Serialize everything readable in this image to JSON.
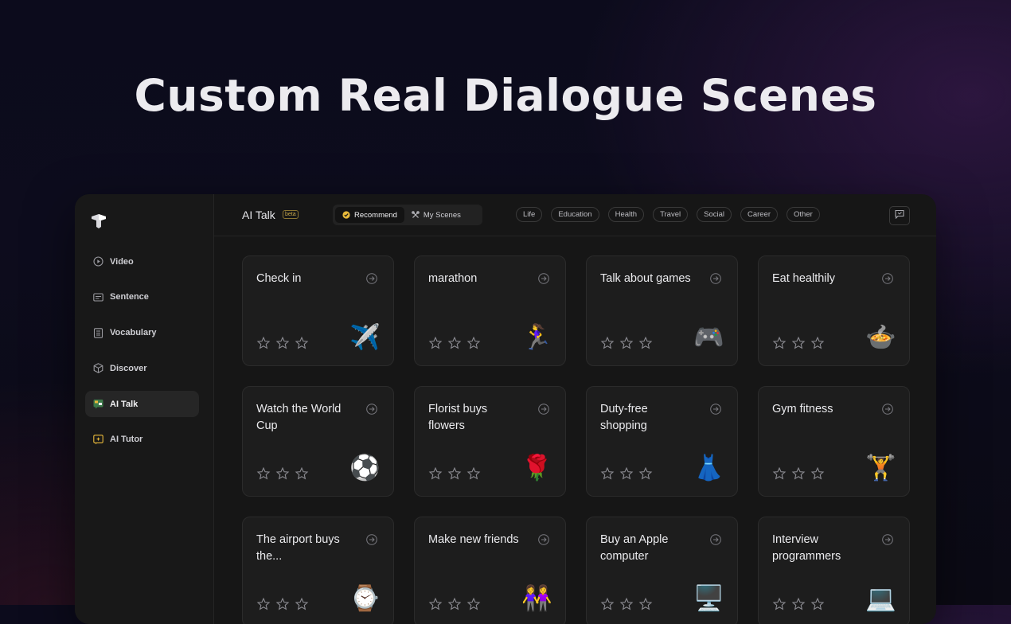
{
  "hero": {
    "title": "Custom Real Dialogue Scenes"
  },
  "sidebar": {
    "items": [
      {
        "label": "Video",
        "icon": "play-circle-icon",
        "active": false
      },
      {
        "label": "Sentence",
        "icon": "subtitle-icon",
        "active": false
      },
      {
        "label": "Vocabulary",
        "icon": "list-icon",
        "active": false
      },
      {
        "label": "Discover",
        "icon": "cube-icon",
        "active": false
      },
      {
        "label": "AI Talk",
        "icon": "ai-talk-icon",
        "active": true
      },
      {
        "label": "AI Tutor",
        "icon": "ai-tutor-icon",
        "active": false
      }
    ]
  },
  "header": {
    "title": "AI Talk",
    "badge": "beta",
    "tabs": [
      {
        "label": "Recommend",
        "active": true
      },
      {
        "label": "My Scenes",
        "active": false
      }
    ],
    "categories": [
      "Life",
      "Education",
      "Health",
      "Travel",
      "Social",
      "Career",
      "Other"
    ]
  },
  "scenes": [
    {
      "title": "Check in",
      "emoji": "✈️",
      "stars": 0
    },
    {
      "title": "marathon",
      "emoji": "🏃‍♀️",
      "stars": 0
    },
    {
      "title": "Talk about games",
      "emoji": "🎮",
      "stars": 0
    },
    {
      "title": "Eat healthily",
      "emoji": "🍲",
      "stars": 0
    },
    {
      "title": "Watch the World Cup",
      "emoji": "⚽",
      "stars": 0
    },
    {
      "title": "Florist buys flowers",
      "emoji": "🌹",
      "stars": 0
    },
    {
      "title": "Duty-free shopping",
      "emoji": "👗",
      "stars": 0
    },
    {
      "title": "Gym fitness",
      "emoji": "🏋️",
      "stars": 0
    },
    {
      "title": "The airport buys the...",
      "emoji": "⌚",
      "stars": 0
    },
    {
      "title": "Make new friends",
      "emoji": "👭",
      "stars": 0
    },
    {
      "title": "Buy an Apple computer",
      "emoji": "🖥️",
      "stars": 0
    },
    {
      "title": "Interview programmers",
      "emoji": "💻",
      "stars": 0
    }
  ],
  "colors": {
    "active_chip": "#e8b93a",
    "card_bg": "#1d1d1d",
    "app_bg": "#161616"
  }
}
